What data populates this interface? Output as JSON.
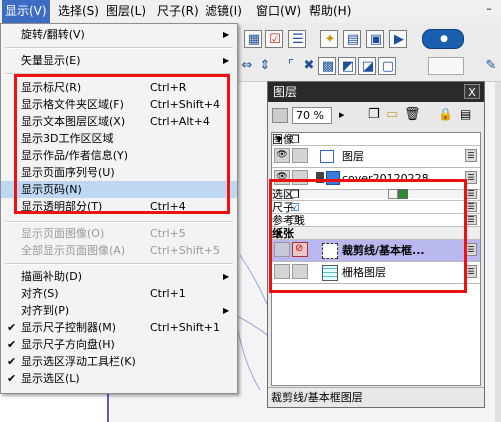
{
  "menubar": {
    "items": [
      {
        "label": "显示(V)",
        "active": true
      },
      {
        "label": "选择(S)"
      },
      {
        "label": "图层(L)"
      },
      {
        "label": "尺子(R)"
      },
      {
        "label": "滤镜(I)"
      },
      {
        "label": "窗口(W)"
      },
      {
        "label": "帮助(H)"
      }
    ],
    "minimize": "–"
  },
  "menu": {
    "items": [
      {
        "label": "旋转/翻转(V)",
        "submenu": true
      },
      {
        "label": "矢量显示(E)",
        "submenu": true
      },
      {
        "label": "显示标尺(R)",
        "shortcut": "Ctrl+R"
      },
      {
        "label": "显示格文件夹区域(F)",
        "shortcut": "Ctrl+Shift+4"
      },
      {
        "label": "显示文本图层区域(X)",
        "shortcut": "Ctrl+Alt+4"
      },
      {
        "label": "显示3D工作区区域"
      },
      {
        "label": "显示作品/作者信息(Y)"
      },
      {
        "label": "显示页面序列号(U)"
      },
      {
        "label": "显示页码(N)"
      },
      {
        "label": "显示透明部分(T)",
        "shortcut": "Ctrl+4"
      },
      {
        "label": "显示页面图像(O)",
        "shortcut": "Ctrl+5",
        "disabled": true
      },
      {
        "label": "全部显示页面图像(A)",
        "shortcut": "Ctrl+Shift+5",
        "disabled": true
      },
      {
        "label": "描画补助(D)",
        "submenu": true
      },
      {
        "label": "对齐(S)",
        "shortcut": "Ctrl+1"
      },
      {
        "label": "对齐到(P)",
        "submenu": true
      },
      {
        "label": "显示尺子控制器(M)",
        "shortcut": "Ctrl+Shift+1",
        "checked": true
      },
      {
        "label": "显示尺子方向盘(H)",
        "checked": true
      },
      {
        "label": "显示选区浮动工具栏(K)",
        "checked": true
      },
      {
        "label": "显示选区(L)",
        "checked": true
      }
    ]
  },
  "layers_panel": {
    "title": "图层",
    "close": "X",
    "opacity": "70 %",
    "opacity_arrow": "▸",
    "rows": {
      "image_group": "图像",
      "layer": "图层",
      "cover": "cover20120228",
      "selection": "选区",
      "ruler": "尺子",
      "reference": "参考线",
      "paper": "纸张",
      "crop": "裁剪线/基本框...",
      "grid": "栅格图层"
    },
    "status": "裁剪线/基本框图层"
  },
  "colors": {
    "highlight": "#bfd8f2",
    "selected_layer": "#b8b8ee",
    "red_box": "#ee1111",
    "menu_active": "#3d6cc4"
  }
}
